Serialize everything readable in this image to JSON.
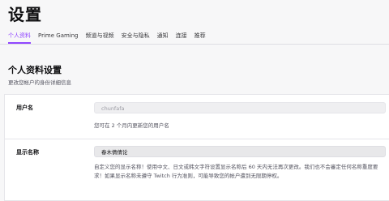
{
  "page": {
    "title": "设置"
  },
  "tabs": [
    {
      "label": "个人资料",
      "active": true
    },
    {
      "label": "Prime Gaming",
      "active": false
    },
    {
      "label": "频道与视频",
      "active": false
    },
    {
      "label": "安全与隐私",
      "active": false
    },
    {
      "label": "通知",
      "active": false
    },
    {
      "label": "连接",
      "active": false
    },
    {
      "label": "推荐",
      "active": false
    }
  ],
  "profile_section": {
    "title": "个人资料设置",
    "subtitle": "更改您帐户的身份详细信息"
  },
  "username": {
    "label": "用户名",
    "value": "chunfafa",
    "hint": "您可在 2 个月内更新您的用户名"
  },
  "display_name": {
    "label": "显示名称",
    "value": "春木倩倩论",
    "hint": "自定义您的显示名称！使用中文、日文或韩文字符设置显示名称后 60 天内无法再次更改。我们也不会審定任何名称重度要求！如果显示名称未遵守 Twitch 行为准则，可能导致您的帐户遭到无限期停权。"
  },
  "colors": {
    "accent": "#9147ff",
    "background": "#f7f7f8",
    "card": "#ffffff",
    "text_secondary": "#53535f"
  }
}
